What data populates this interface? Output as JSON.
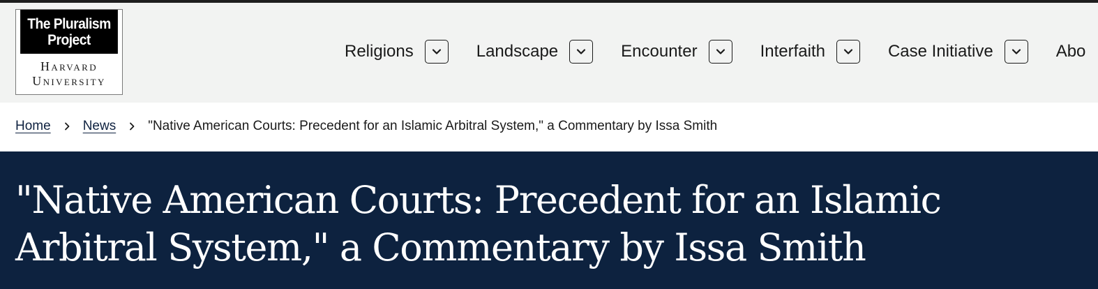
{
  "logo": {
    "line1": "The Pluralism",
    "line2": "Project",
    "line3": "Harvard",
    "line4": "University"
  },
  "nav": {
    "items": [
      {
        "label": "Religions"
      },
      {
        "label": "Landscape"
      },
      {
        "label": "Encounter"
      },
      {
        "label": "Interfaith"
      },
      {
        "label": "Case Initiative"
      },
      {
        "label": "Abo"
      }
    ]
  },
  "breadcrumb": {
    "home": "Home",
    "news": "News",
    "current": "\"Native American Courts: Precedent for an Islamic Arbitral System,\" a Commentary by Issa Smith"
  },
  "page": {
    "title": "\"Native American Courts: Precedent for an Islamic Arbitral System,\" a Commentary by Issa Smith"
  },
  "colors": {
    "header_bg": "#f2f3f2",
    "hero_bg": "#0d223f",
    "link": "#0f2240"
  },
  "icons": {
    "nav_toggle": "chevron-down-icon",
    "breadcrumb_separator": "chevron-right-icon"
  }
}
